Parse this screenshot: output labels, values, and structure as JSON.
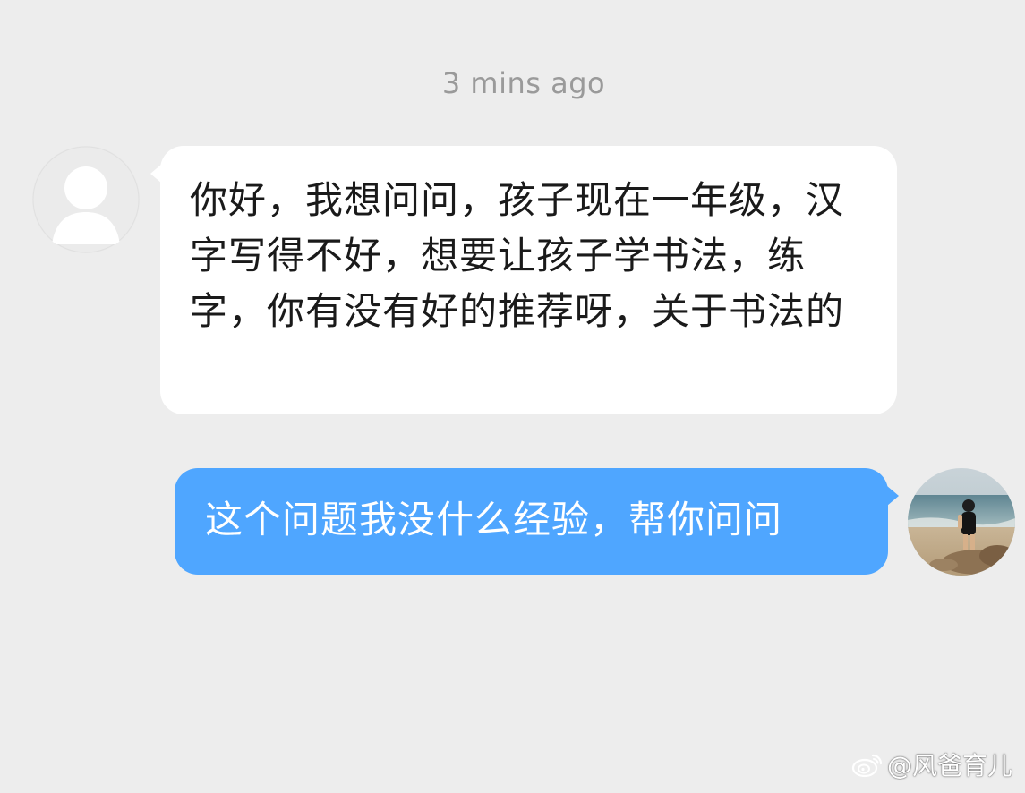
{
  "chat": {
    "timestamp": "3 mins ago",
    "messages": [
      {
        "sender": "other",
        "avatar_icon": "default-user-silhouette-icon",
        "text": "你好，我想问问，孩子现在一年级，汉字写得不好，想要让孩子学书法，练字，你有没有好的推荐呀，关于书法的"
      },
      {
        "sender": "me",
        "avatar_icon": "profile-photo-child-at-beach",
        "text": "这个问题我没什么经验，帮你问问"
      }
    ]
  },
  "watermark": {
    "icon": "weibo-logo-icon",
    "text": "@风爸育儿"
  },
  "colors": {
    "background": "#ededed",
    "incoming_bubble": "#ffffff",
    "outgoing_bubble": "#4fa6ff",
    "timestamp": "#9a9a9a"
  }
}
